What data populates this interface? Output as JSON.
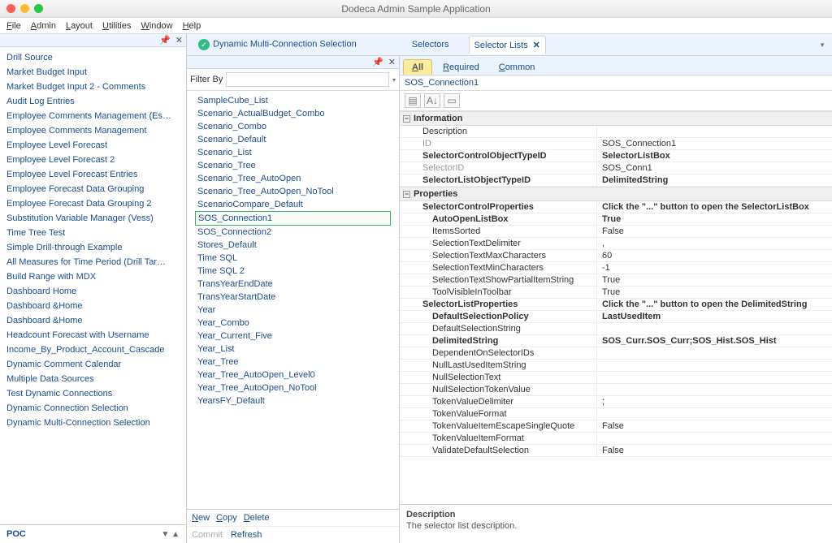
{
  "title": "Dodeca Admin Sample Application",
  "menu": {
    "file": "File",
    "admin": "Admin",
    "layout": "Layout",
    "utilities": "Utilities",
    "window": "Window",
    "help": "Help"
  },
  "left": {
    "items": [
      "Drill Source",
      "Market Budget Input",
      "Market Budget Input 2 - Comments",
      "Audit Log Entries",
      "Employee Comments Management (Es…",
      "Employee Comments Management",
      "Employee Level Forecast",
      "Employee Level Forecast 2",
      "Employee Level Forecast Entries",
      "Employee Forecast Data Grouping",
      "Employee Forecast Data Grouping 2",
      "Substitution Variable Manager (Vess)",
      "Time Tree Test",
      "Simple Drill-through Example",
      "All Measures for Time Period (Drill Tar…",
      "Build Range with MDX",
      "Dashboard Home",
      "Dashboard &Home",
      "Dashboard &Home",
      "Headcount Forecast with Username",
      "Income_By_Product_Account_Cascade",
      "Dynamic Comment Calendar",
      "Multiple Data Sources",
      "Test Dynamic Connections",
      "Dynamic Connection Selection",
      "Dynamic Multi-Connection Selection"
    ],
    "footer": "POC"
  },
  "topTabs": {
    "main": "Dynamic Multi-Connection Selection",
    "selectors": "Selectors",
    "lists": "Selector Lists"
  },
  "filter": {
    "label": "Filter By",
    "value": ""
  },
  "midItems": [
    "SampleCube_List",
    "Scenario_ActualBudget_Combo",
    "Scenario_Combo",
    "Scenario_Default",
    "Scenario_List",
    "Scenario_Tree",
    "Scenario_Tree_AutoOpen",
    "Scenario_Tree_AutoOpen_NoTool",
    "ScenarioCompare_Default",
    "SOS_Connection1",
    "SOS_Connection2",
    "Stores_Default",
    "Time SQL",
    "Time SQL 2",
    "TransYearEndDate",
    "TransYearStartDate",
    "Year",
    "Year_Combo",
    "Year_Current_Five",
    "Year_List",
    "Year_Tree",
    "Year_Tree_AutoOpen_Level0",
    "Year_Tree_AutoOpen_NoTool",
    "YearsFY_Default"
  ],
  "midSelected": "SOS_Connection1",
  "midFoot": {
    "new": "New",
    "copy": "Copy",
    "del": "Delete",
    "commit": "Commit",
    "refresh": "Refresh"
  },
  "subTabs": {
    "all": "All",
    "required": "Required",
    "common": "Common"
  },
  "objTitle": "SOS_Connection1",
  "categories": {
    "information": "Information",
    "properties": "Properties"
  },
  "props": {
    "info": [
      {
        "k": "Description",
        "v": ""
      },
      {
        "k": "ID",
        "v": "SOS_Connection1",
        "dim": true
      },
      {
        "k": "SelectorControlObjectTypeID",
        "v": "SelectorListBox",
        "bold": true
      },
      {
        "k": "SelectorID",
        "v": "SOS_Conn1",
        "dim": true
      },
      {
        "k": "SelectorListObjectTypeID",
        "v": "DelimitedString",
        "bold": true
      }
    ],
    "scp": {
      "k": "SelectorControlProperties",
      "v": "Click the \"...\" button to open the SelectorListBox"
    },
    "scpItems": [
      {
        "k": "AutoOpenListBox",
        "v": "True",
        "bold": true
      },
      {
        "k": "ItemsSorted",
        "v": "False"
      },
      {
        "k": "SelectionTextDelimiter",
        "v": ","
      },
      {
        "k": "SelectionTextMaxCharacters",
        "v": "60"
      },
      {
        "k": "SelectionTextMinCharacters",
        "v": "-1"
      },
      {
        "k": "SelectionTextShowPartialItemString",
        "v": "True"
      },
      {
        "k": "ToolVisibleInToolbar",
        "v": "True"
      }
    ],
    "slp": {
      "k": "SelectorListProperties",
      "v": "Click the \"...\" button to open the DelimitedString"
    },
    "slpItems": [
      {
        "k": "DefaultSelectionPolicy",
        "v": "LastUsedItem",
        "bold": true
      },
      {
        "k": "DefaultSelectionString",
        "v": ""
      },
      {
        "k": "DelimitedString",
        "v": "SOS_Curr.SOS_Curr;SOS_Hist.SOS_Hist",
        "bold": true
      },
      {
        "k": "DependentOnSelectorIDs",
        "v": ""
      },
      {
        "k": "NullLastUsedItemString",
        "v": ""
      },
      {
        "k": "NullSelectionText",
        "v": ""
      },
      {
        "k": "NullSelectionTokenValue",
        "v": ""
      },
      {
        "k": "TokenValueDelimiter",
        "v": ";"
      },
      {
        "k": "TokenValueFormat",
        "v": ""
      },
      {
        "k": "TokenValueItemEscapeSingleQuote",
        "v": "False"
      },
      {
        "k": "TokenValueItemFormat",
        "v": ""
      },
      {
        "k": "ValidateDefaultSelection",
        "v": "False"
      }
    ]
  },
  "desc": {
    "title": "Description",
    "text": "The selector list description."
  }
}
